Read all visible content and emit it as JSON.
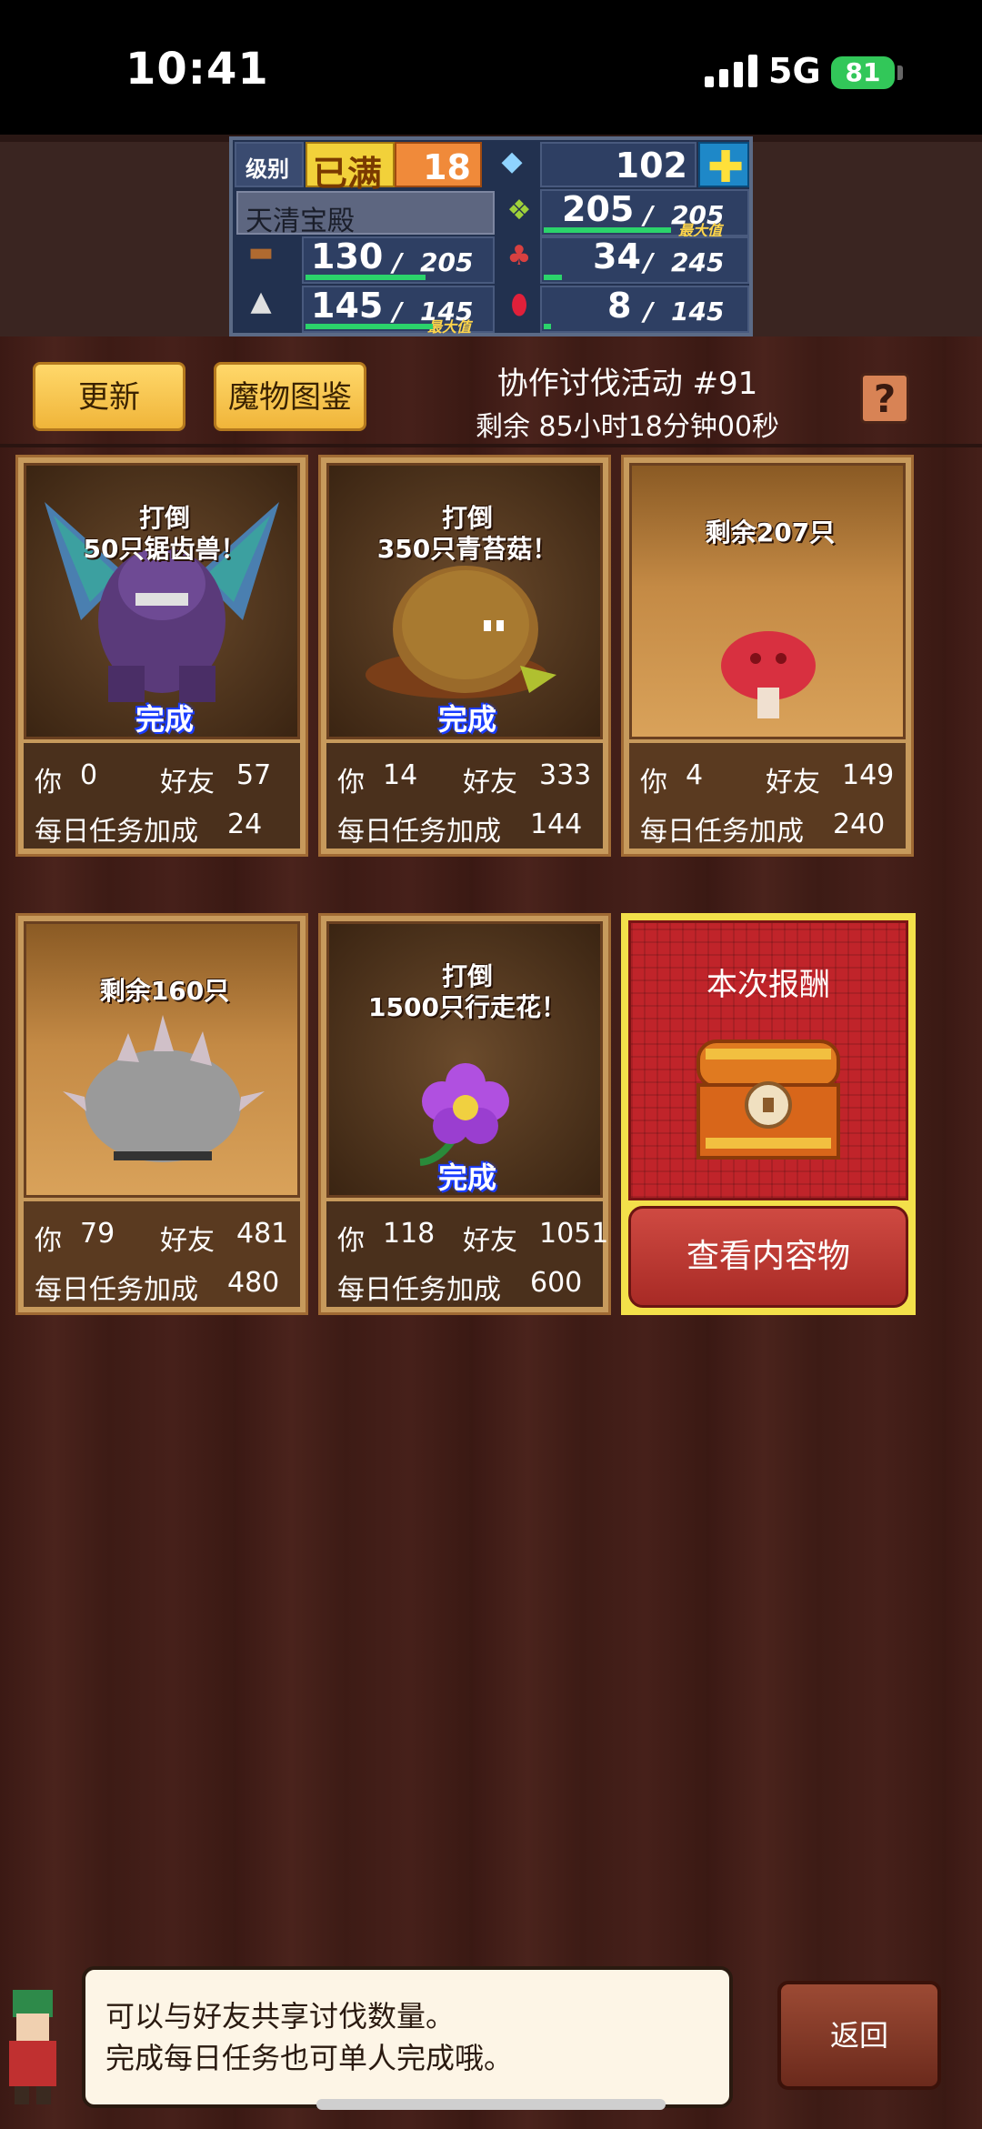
{
  "status_bar": {
    "time": "10:41",
    "network": "5G",
    "battery": "81"
  },
  "resources": {
    "level_label": "级别",
    "level_status": "已满",
    "level": "18",
    "gems": "102",
    "location": "天清宝殿",
    "grass": "205",
    "grass_max": "205",
    "grass_max_tag": "最大值",
    "wood": "130",
    "wood_max": "205",
    "food": "34",
    "food_max": "245",
    "ore": "145",
    "ore_max": "145",
    "ore_max_tag": "最大值",
    "ruby": "8",
    "ruby_max": "145"
  },
  "header": {
    "refresh_label": "更新",
    "bestiary_label": "魔物图鉴",
    "event_title": "协作讨伐活动 #91",
    "time_remaining": "剩余 85小时18分钟00秒",
    "help_label": "?"
  },
  "labels": {
    "you": "你",
    "friends": "好友",
    "daily": "每日任务加成"
  },
  "cards": [
    {
      "title_line1": "打倒",
      "title_line2": "50只锯齿兽！",
      "status": "完成",
      "you": "0",
      "friends": "57",
      "daily": "24",
      "monster": "sawtooth-beast"
    },
    {
      "title_line1": "打倒",
      "title_line2": "350只青苔菇！",
      "status": "完成",
      "you": "14",
      "friends": "333",
      "daily": "144",
      "monster": "moss-mushroom"
    },
    {
      "title_line1": "剩余207只",
      "title_line2": "",
      "status": "",
      "you": "4",
      "friends": "149",
      "daily": "240",
      "monster": "red-mushroom"
    },
    {
      "title_line1": "剩余160只",
      "title_line2": "",
      "status": "",
      "you": "79",
      "friends": "481",
      "daily": "480",
      "monster": "spiked-rock"
    },
    {
      "title_line1": "打倒",
      "title_line2": "1500只行走花！",
      "status": "完成",
      "you": "118",
      "friends": "1051",
      "daily": "600",
      "monster": "walking-flower"
    }
  ],
  "reward": {
    "title": "本次报酬",
    "button": "查看内容物"
  },
  "footer": {
    "message_line1": "可以与好友共享讨伐数量。",
    "message_line2": "完成每日任务也可单人完成哦。",
    "back_label": "返回"
  }
}
